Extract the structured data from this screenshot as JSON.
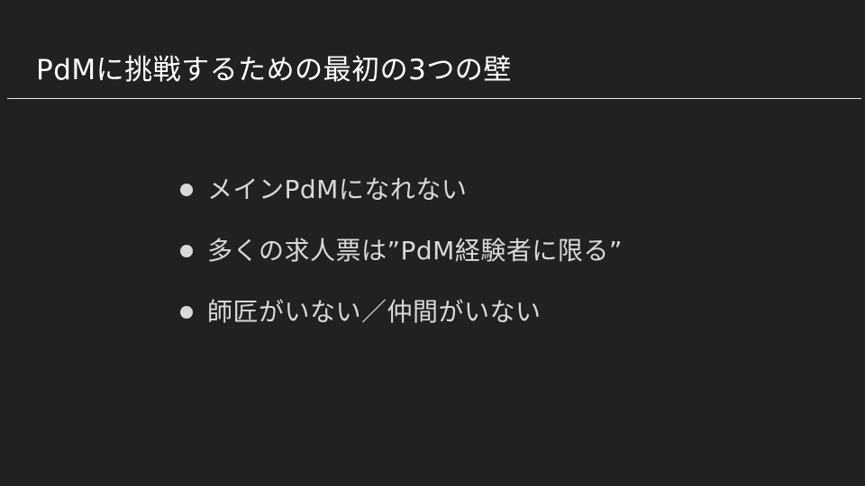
{
  "slide": {
    "title": "PdMに挑戦するための最初の3つの壁",
    "bullets": [
      {
        "text": "メインPdMになれない"
      },
      {
        "text": "多くの求人票は”PdM経験者に限る”"
      },
      {
        "text": "師匠がいない／仲間がいない"
      }
    ]
  },
  "colors": {
    "background": "#212121",
    "title": "#ffffff",
    "bullet_text": "#d9d9d9",
    "divider": "#e6e6e6"
  }
}
